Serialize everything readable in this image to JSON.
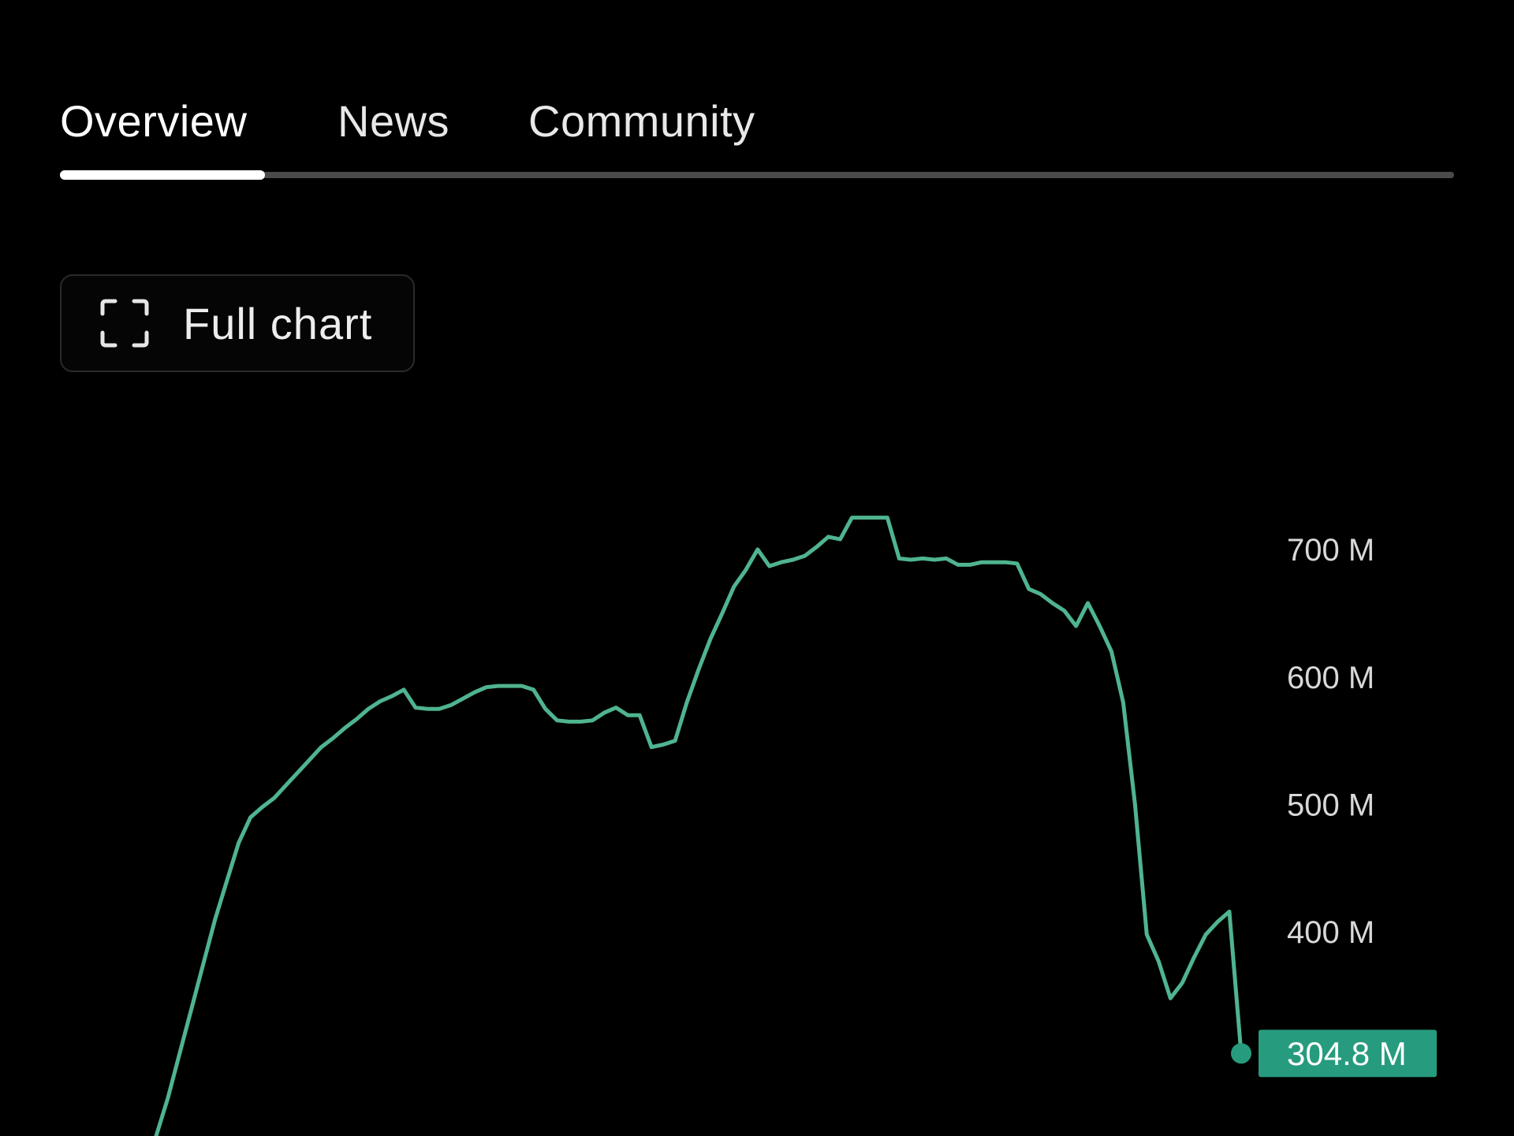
{
  "tabs": [
    {
      "label": "Overview",
      "active": true
    },
    {
      "label": "News",
      "active": false
    },
    {
      "label": "Community",
      "active": false
    }
  ],
  "toolbar": {
    "full_chart_label": "Full chart",
    "full_chart_icon": "fullscreen-corners-icon"
  },
  "colors": {
    "background": "#000000",
    "line": "#4fb48f",
    "badge": "#279b7e",
    "axis_text": "#d8d8d8"
  },
  "chart_data": {
    "type": "line",
    "title": "",
    "xlabel": "",
    "ylabel": "",
    "y_axis_position": "right",
    "grid": false,
    "yticks": [
      400,
      500,
      600,
      700
    ],
    "ytick_labels": [
      "400 M",
      "500 M",
      "600 M",
      "700 M"
    ],
    "ylim": [
      240,
      760
    ],
    "last_value_label": "304.8 M",
    "series": [
      {
        "values": [
          240,
          270,
          305,
          340,
          375,
          410,
          440,
          470,
          490,
          498,
          505,
          515,
          525,
          535,
          545,
          552,
          560,
          567,
          575,
          581,
          585,
          590,
          576,
          575,
          575,
          578,
          583,
          588,
          592,
          593,
          593,
          593,
          590,
          575,
          566,
          565,
          565,
          566,
          572,
          576,
          570,
          570,
          545,
          547,
          550,
          580,
          606,
          630,
          650,
          671,
          684,
          700,
          687,
          690,
          692,
          695,
          702,
          710,
          708,
          725,
          725,
          725,
          725,
          693,
          692,
          693,
          692,
          693,
          688,
          688,
          690,
          690,
          690,
          689,
          669,
          665,
          658,
          652,
          640,
          658,
          640,
          620,
          580,
          500,
          398,
          377,
          348,
          360,
          380,
          398,
          408,
          416,
          304.8
        ]
      }
    ]
  }
}
